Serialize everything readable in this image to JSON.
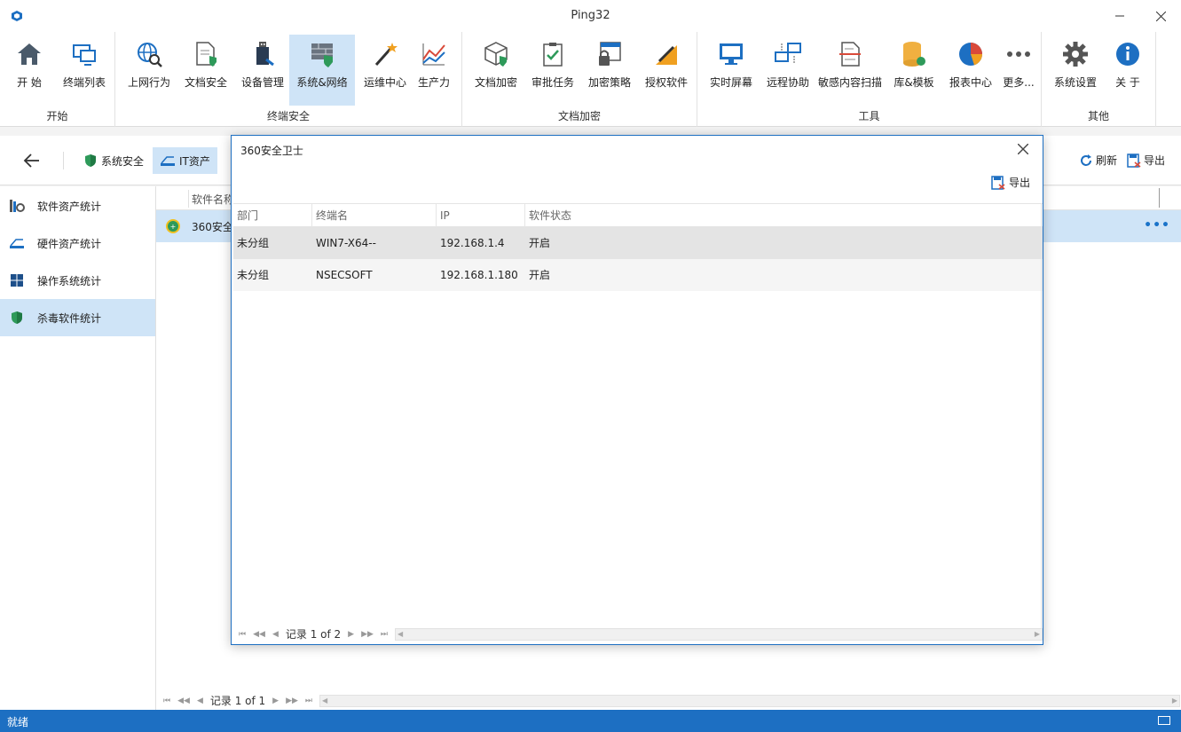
{
  "window": {
    "title": "Ping32"
  },
  "ribbon": {
    "groups": [
      {
        "label": "开始",
        "buttons": [
          {
            "label": "开  始",
            "icon": "home-icon"
          },
          {
            "label": "终端列表",
            "icon": "terminal-list-icon"
          }
        ]
      },
      {
        "label": "终端安全",
        "buttons": [
          {
            "label": "上网行为",
            "icon": "web-behavior-icon"
          },
          {
            "label": "文档安全",
            "icon": "document-security-icon"
          },
          {
            "label": "设备管理",
            "icon": "device-management-icon"
          },
          {
            "label": "系统&网络",
            "icon": "system-network-icon"
          },
          {
            "label": "运维中心",
            "icon": "ops-center-icon"
          },
          {
            "label": "生产力",
            "icon": "productivity-icon"
          }
        ]
      },
      {
        "label": "文档加密",
        "buttons": [
          {
            "label": "文档加密",
            "icon": "doc-encryption-icon"
          },
          {
            "label": "审批任务",
            "icon": "approval-task-icon"
          },
          {
            "label": "加密策略",
            "icon": "encryption-policy-icon"
          },
          {
            "label": "授权软件",
            "icon": "authorized-software-icon"
          }
        ]
      },
      {
        "label": "工具",
        "buttons": [
          {
            "label": "实时屏幕",
            "icon": "realtime-screen-icon"
          },
          {
            "label": "远程协助",
            "icon": "remote-assist-icon"
          },
          {
            "label": "敏感内容扫描",
            "icon": "sensitive-scan-icon"
          },
          {
            "label": "库&模板",
            "icon": "library-template-icon"
          },
          {
            "label": "报表中心",
            "icon": "report-center-icon"
          },
          {
            "label": "更多...",
            "icon": "more-icon"
          }
        ]
      },
      {
        "label": "其他",
        "buttons": [
          {
            "label": "系统设置",
            "icon": "gear-icon"
          },
          {
            "label": "关  于",
            "icon": "info-icon"
          }
        ]
      }
    ]
  },
  "navbar": {
    "tabs": [
      {
        "label": "系统安全",
        "icon": "shield-icon"
      },
      {
        "label": "IT资产",
        "icon": "it-asset-icon"
      }
    ],
    "refresh_label": "刷新",
    "export_label": "导出"
  },
  "leftpanel": {
    "items": [
      {
        "label": "软件资产统计",
        "icon": "software-asset-icon"
      },
      {
        "label": "硬件资产统计",
        "icon": "hardware-asset-icon"
      },
      {
        "label": "操作系统统计",
        "icon": "windows-icon"
      },
      {
        "label": "杀毒软件统计",
        "icon": "antivirus-shield-icon"
      }
    ]
  },
  "maingrid": {
    "column_header": "软件名称",
    "row_text": "360安全",
    "more": "•••",
    "pager_text": "记录 1 of 1"
  },
  "dialog": {
    "title": "360安全卫士",
    "export_label": "导出",
    "columns": [
      "部门",
      "终端名",
      "IP",
      "软件状态"
    ],
    "rows": [
      [
        "未分组",
        "WIN7-X64--",
        "192.168.1.4",
        "开启"
      ],
      [
        "未分组",
        "NSECSOFT",
        "192.168.1.180",
        "开启"
      ]
    ],
    "pager_text": "记录 1 of 2"
  },
  "statusbar": {
    "text": "就绪"
  },
  "colors": {
    "accent": "#1d6fc2",
    "selection": "#cfe4f7",
    "status_bar": "#1d6fc2"
  }
}
